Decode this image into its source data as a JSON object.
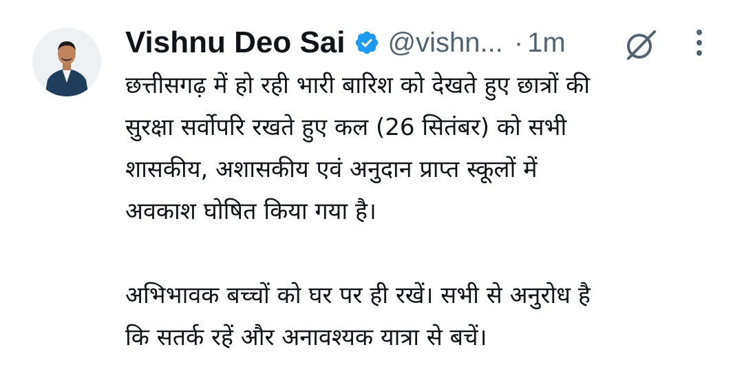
{
  "tweet": {
    "author_name": "Vishnu Deo Sai",
    "handle": "@vishn...",
    "separator": "·",
    "timestamp": "1m",
    "paragraphs": [
      [
        "छत्तीसगढ़ में हो रही भारी बारिश को देखते हुए छात्रों की",
        "सुरक्षा सर्वोपरि रखते हुए कल (26 सितंबर) को सभी",
        "शासकीय, अशासकीय एवं अनुदान प्राप्त स्कूलों में",
        "अवकाश घोषित किया गया है।"
      ],
      [
        "अभिभावक बच्चों को घर पर ही रखें। सभी से अनुरोध है",
        "कि सतर्क रहें और अनावश्यक यात्रा से बचें।"
      ]
    ]
  },
  "icons": {
    "avatar": "profile-photo",
    "verified": "verified-badge-icon",
    "grok": "grok-icon",
    "more": "more-options-icon"
  },
  "colors": {
    "text": "#0f1419",
    "secondary": "#536471",
    "verified_blue": "#1d9bf0",
    "background": "#ffffff"
  }
}
